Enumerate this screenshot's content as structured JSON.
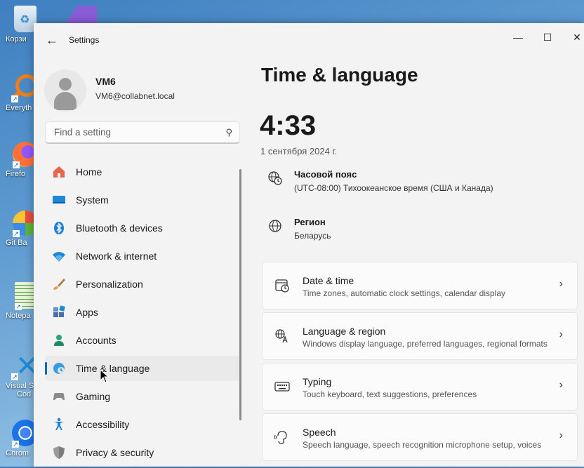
{
  "desktop": {
    "icons": [
      {
        "label": "Корзи",
        "icon": "recycle-bin-icon"
      },
      {
        "label": "Everyth",
        "icon": "everything-search-icon"
      },
      {
        "label": "Firefo",
        "icon": "firefox-icon"
      },
      {
        "label": "Git Ba",
        "icon": "git-bash-icon"
      },
      {
        "label": "Notepa",
        "icon": "notepad-icon"
      },
      {
        "label": "Visual St",
        "label2": "Cod",
        "icon": "vscode-icon"
      },
      {
        "label": "Chrom",
        "icon": "chrome-icon"
      }
    ]
  },
  "window": {
    "title": "Settings",
    "back_glyph": "←",
    "controls": {
      "minimize": "—",
      "maximize": "☐",
      "close": "✕"
    }
  },
  "user": {
    "name": "VM6",
    "email": "VM6@collabnet.local"
  },
  "search": {
    "placeholder": "Find a setting"
  },
  "nav": {
    "items": [
      {
        "label": "Home",
        "icon": "home-icon"
      },
      {
        "label": "System",
        "icon": "system-icon"
      },
      {
        "label": "Bluetooth & devices",
        "icon": "bluetooth-icon"
      },
      {
        "label": "Network & internet",
        "icon": "wifi-icon"
      },
      {
        "label": "Personalization",
        "icon": "brush-icon"
      },
      {
        "label": "Apps",
        "icon": "apps-icon"
      },
      {
        "label": "Accounts",
        "icon": "accounts-icon"
      },
      {
        "label": "Time & language",
        "icon": "time-language-icon",
        "active": true
      },
      {
        "label": "Gaming",
        "icon": "gaming-icon"
      },
      {
        "label": "Accessibility",
        "icon": "accessibility-icon"
      },
      {
        "label": "Privacy & security",
        "icon": "shield-icon"
      }
    ]
  },
  "main": {
    "title": "Time & language",
    "clock": "4:33",
    "date": "1 сентября 2024 г.",
    "timezone": {
      "title": "Часовой пояс",
      "value": "(UTC-08:00) Тихоокеанское время (США и Канада)"
    },
    "region": {
      "title": "Регион",
      "value": "Беларусь"
    },
    "cards": [
      {
        "title": "Date & time",
        "subtitle": "Time zones, automatic clock settings, calendar display",
        "icon": "date-time-icon"
      },
      {
        "title": "Language & region",
        "subtitle": "Windows display language, preferred languages, regional formats",
        "icon": "language-icon"
      },
      {
        "title": "Typing",
        "subtitle": "Touch keyboard, text suggestions, preferences",
        "icon": "keyboard-icon"
      },
      {
        "title": "Speech",
        "subtitle": "Speech language, speech recognition microphone setup, voices",
        "icon": "speech-icon"
      }
    ],
    "chevron": "›"
  },
  "colors": {
    "accent": "#0067c0",
    "window_bg": "#f3f3f3",
    "card_bg": "#fbfbfb"
  }
}
